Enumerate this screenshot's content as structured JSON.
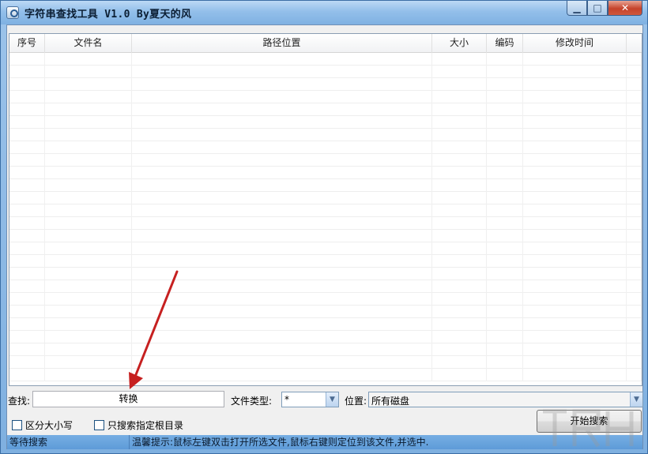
{
  "window": {
    "title": "字符串查找工具 V1.0 By夏天的风",
    "controls": {
      "minimize": "▁",
      "maximize": "□",
      "close": "✕"
    }
  },
  "list": {
    "columns": [
      "序号",
      "文件名",
      "路径位置",
      "大小",
      "编码",
      "修改时间"
    ],
    "rows": []
  },
  "search": {
    "label": "查找:",
    "value": "转换"
  },
  "file_type": {
    "label": "文件类型:",
    "value": "*"
  },
  "location": {
    "label": "位置:",
    "value": "所有磁盘"
  },
  "options": {
    "case_sensitive": {
      "label": "区分大小写",
      "checked": false
    },
    "root_only": {
      "label": "只搜索指定根目录",
      "checked": false
    }
  },
  "start_button": {
    "label": "开始搜索"
  },
  "status": {
    "state": "等待搜索",
    "tip": "温馨提示:鼠标左键双击打开所选文件,鼠标右键则定位到该文件,并选中."
  },
  "colors": {
    "annotation_arrow": "#c62020",
    "titlebar": "#93bfea",
    "statusbar": "#6ea8e0"
  }
}
